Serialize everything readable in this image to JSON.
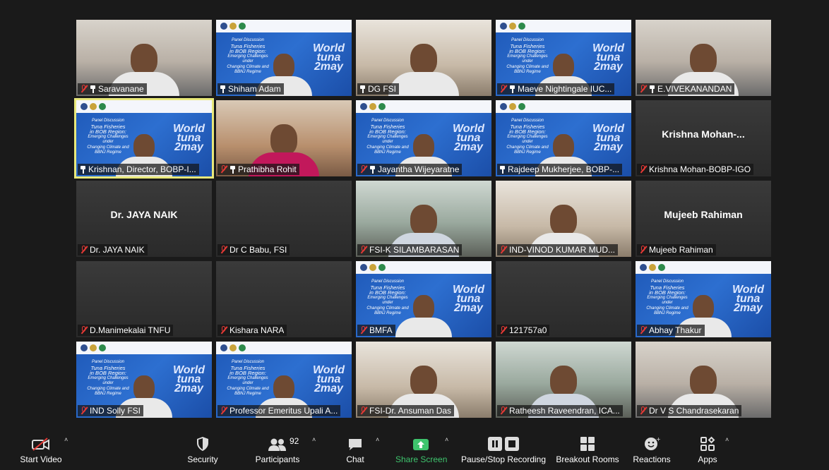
{
  "participants_tiles": [
    {
      "name": "Saravanane",
      "mic_muted": true,
      "pinned": true,
      "video": "room"
    },
    {
      "name": "Shiham Adam",
      "mic_muted": false,
      "pinned": true,
      "video": "banner"
    },
    {
      "name": "DG  FSI",
      "mic_muted": false,
      "pinned": true,
      "video": "office"
    },
    {
      "name": "Maeve Nightingale IUC...",
      "mic_muted": true,
      "pinned": true,
      "video": "banner"
    },
    {
      "name": "E.VIVEKANANDAN",
      "mic_muted": true,
      "pinned": true,
      "video": "room"
    },
    {
      "name": "Krishnan, Director, BOBP-I...",
      "mic_muted": false,
      "pinned": true,
      "video": "banner",
      "active": true
    },
    {
      "name": "Prathibha Rohit",
      "mic_muted": true,
      "pinned": true,
      "video": "warm"
    },
    {
      "name": "Jayantha Wijeyaratne",
      "mic_muted": true,
      "pinned": true,
      "video": "banner"
    },
    {
      "name": "Rajdeep Mukherjee, BOBP-...",
      "mic_muted": false,
      "pinned": true,
      "video": "banner"
    },
    {
      "name": "Krishna Mohan-BOBP-IGO",
      "mic_muted": true,
      "pinned": false,
      "video": "none",
      "display_name": "Krishna  Mohan-..."
    },
    {
      "name": "Dr. JAYA NAIK",
      "mic_muted": true,
      "pinned": false,
      "video": "none",
      "display_name": "Dr. JAYA NAIK"
    },
    {
      "name": "Dr C Babu, FSI",
      "mic_muted": true,
      "pinned": false,
      "video": "none"
    },
    {
      "name": "FSI-K SILAMBARASAN",
      "mic_muted": true,
      "pinned": false,
      "video": "green"
    },
    {
      "name": "IND-VINOD KUMAR MUD...",
      "mic_muted": true,
      "pinned": false,
      "video": "office"
    },
    {
      "name": "Mujeeb Rahiman",
      "mic_muted": true,
      "pinned": false,
      "video": "none",
      "display_name": "Mujeeb Rahiman"
    },
    {
      "name": "D.Manimekalai TNFU",
      "mic_muted": true,
      "pinned": false,
      "video": "none"
    },
    {
      "name": "Kishara NARA",
      "mic_muted": true,
      "pinned": false,
      "video": "none"
    },
    {
      "name": "BMFA",
      "mic_muted": true,
      "pinned": false,
      "video": "banner"
    },
    {
      "name": "121757a0",
      "mic_muted": true,
      "pinned": false,
      "video": "none"
    },
    {
      "name": "Abhay Thakur",
      "mic_muted": true,
      "pinned": false,
      "video": "banner"
    },
    {
      "name": "IND Solly FSI",
      "mic_muted": true,
      "pinned": false,
      "video": "banner"
    },
    {
      "name": "Professor Emeritus Upali A...",
      "mic_muted": true,
      "pinned": false,
      "video": "banner"
    },
    {
      "name": "FSI-Dr. Ansuman Das",
      "mic_muted": true,
      "pinned": false,
      "video": "office"
    },
    {
      "name": "Ratheesh Raveendran,  ICA...",
      "mic_muted": true,
      "pinned": false,
      "video": "green"
    },
    {
      "name": "Dr V S Chandrasekaran",
      "mic_muted": true,
      "pinned": false,
      "video": "room"
    }
  ],
  "banner": {
    "lines": [
      "Panel Discussion",
      "Tuna Fisheries",
      "in BOB Region:",
      "Emerging Challenges under",
      "Changing Climate and",
      "BBNJ Regime"
    ],
    "wt": [
      "World",
      "tuna",
      "2may"
    ]
  },
  "toolbar": {
    "start_video": "Start Video",
    "security": "Security",
    "participants": "Participants",
    "participants_count": "92",
    "chat": "Chat",
    "share_screen": "Share Screen",
    "recording": "Pause/Stop Recording",
    "breakout": "Breakout Rooms",
    "reactions": "Reactions",
    "apps": "Apps"
  },
  "colors": {
    "active_border": "#e8e87a",
    "muted_red": "#e53935",
    "share_green": "#3ec46d",
    "banner_blue": "#2d6fd0"
  }
}
